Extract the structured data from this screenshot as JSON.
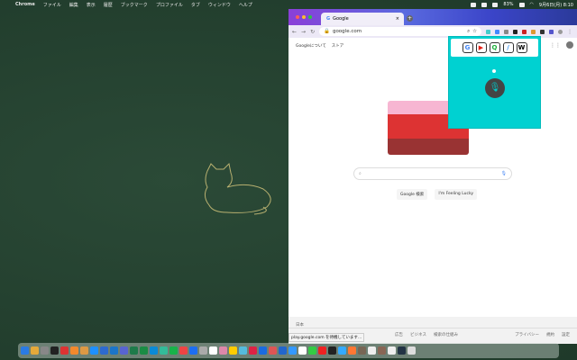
{
  "menubar": {
    "items": [
      "Chrome",
      "ファイル",
      "編集",
      "表示",
      "履歴",
      "ブックマーク",
      "プロファイル",
      "タブ",
      "ウィンドウ",
      "ヘルプ"
    ],
    "battery": "83%",
    "datetime": "9月6日(月) 8:10"
  },
  "browser": {
    "tab_title": "Google",
    "url": "google.com",
    "top_links": [
      "Googleについて",
      "ストア"
    ],
    "search_buttons": [
      "Google 検索",
      "I'm Feeling Lucky"
    ],
    "footer_country": "日本",
    "footer_links_left": [
      "広告",
      "ビジネス",
      "検索の仕組み"
    ],
    "footer_links_right": [
      "プライバシー",
      "規約",
      "設定"
    ],
    "status_text": "play.google.com を待機しています..."
  },
  "popup": {
    "shortcuts": [
      {
        "label": "G",
        "color": "#4285f4"
      },
      {
        "label": "▶",
        "color": "#e62117"
      },
      {
        "label": "Q",
        "color": "#1db03b"
      },
      {
        "label": "/",
        "color": "#2a8cf0"
      },
      {
        "label": "W",
        "color": "#000000"
      }
    ]
  },
  "dock_colors": [
    "#2a7be4",
    "#e5a93a",
    "#888",
    "#222",
    "#d33",
    "#f2892d",
    "#d94",
    "#1e90ff",
    "#2d6acf",
    "#1b75c9",
    "#5864d1",
    "#1e7a4a",
    "#1a8c44",
    "#0a8ad6",
    "#3b9",
    "#18b34a",
    "#e44",
    "#1c6ef2",
    "#aaa",
    "#fff",
    "#d8a",
    "#fc0",
    "#5bd",
    "#d24",
    "#1a6be0",
    "#d55",
    "#26c",
    "#39f",
    "#fff",
    "#3c4",
    "#e22",
    "#222",
    "#3af",
    "#f73",
    "#765",
    "#eee",
    "#865",
    "#eee",
    "#234",
    "#ddd"
  ]
}
